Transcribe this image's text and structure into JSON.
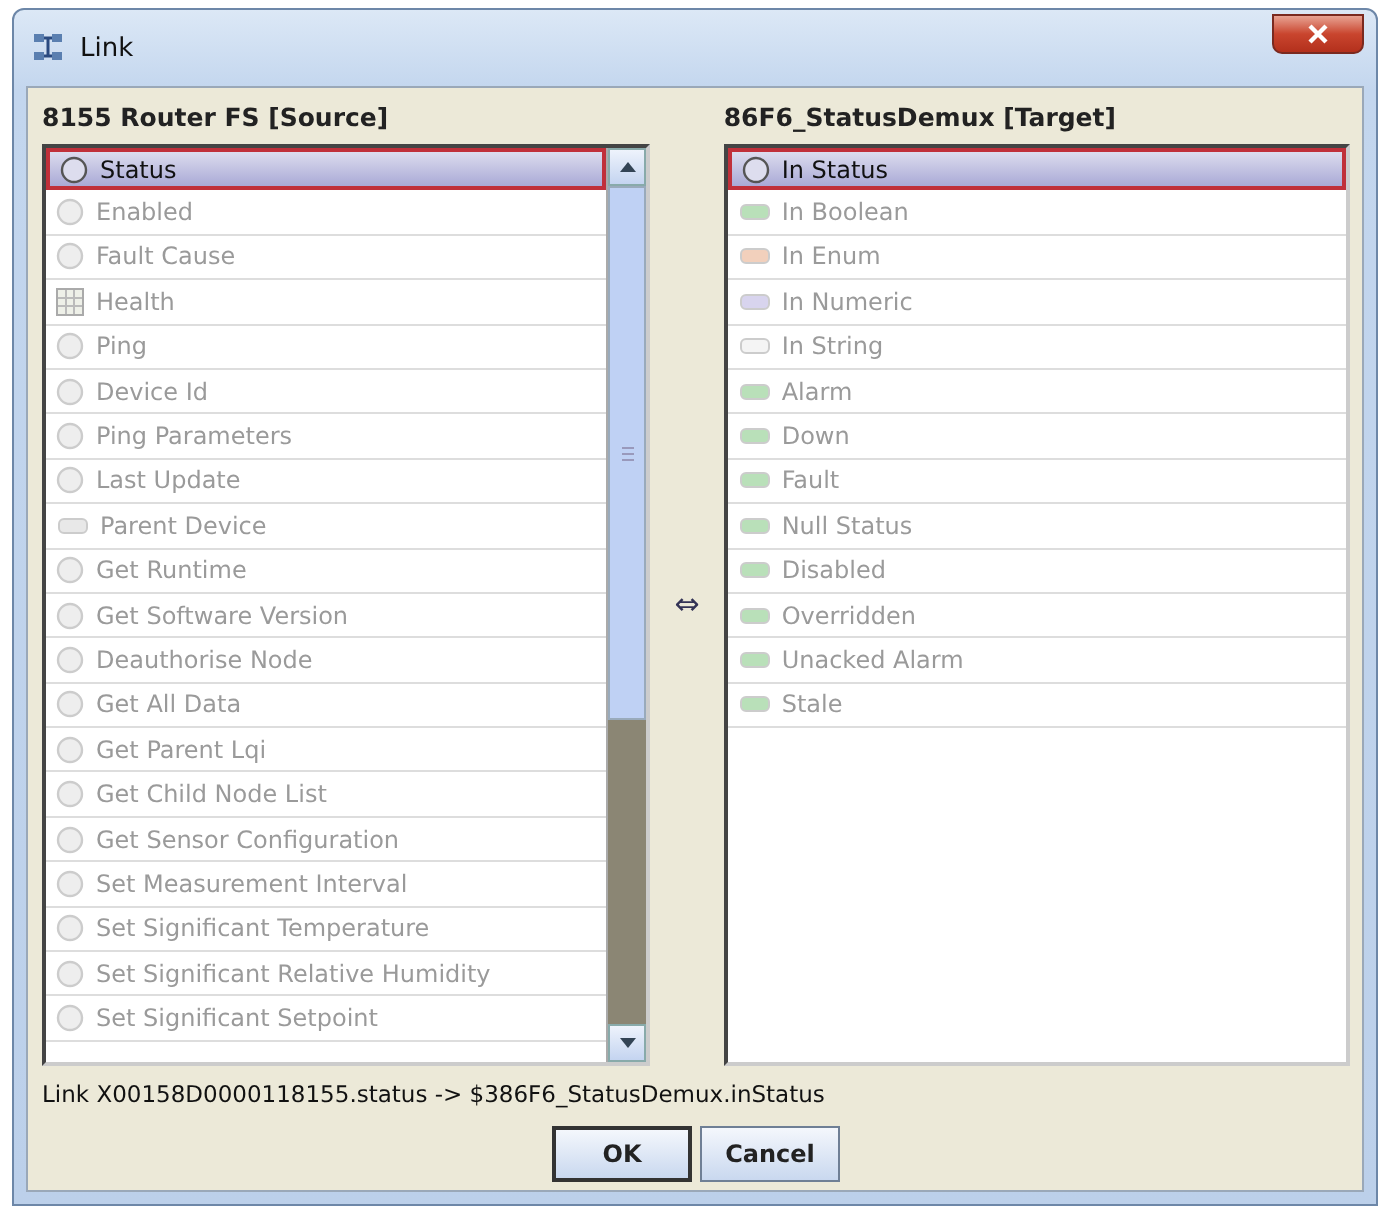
{
  "window": {
    "title": "Link"
  },
  "source": {
    "title": "8155 Router FS [Source]",
    "items": [
      {
        "label": "Status",
        "kind": "circle",
        "selected": true
      },
      {
        "label": "Enabled",
        "kind": "circle",
        "selected": false
      },
      {
        "label": "Fault Cause",
        "kind": "circle",
        "selected": false
      },
      {
        "label": "Health",
        "kind": "grid",
        "selected": false
      },
      {
        "label": "Ping",
        "kind": "circle",
        "selected": false
      },
      {
        "label": "Device Id",
        "kind": "circle",
        "selected": false
      },
      {
        "label": "Ping Parameters",
        "kind": "circle",
        "selected": false
      },
      {
        "label": "Last Update",
        "kind": "circle",
        "selected": false
      },
      {
        "label": "Parent Device",
        "kind": "pill",
        "color": "#e8e8e8",
        "selected": false
      },
      {
        "label": "Get Runtime",
        "kind": "circle",
        "selected": false
      },
      {
        "label": "Get Software Version",
        "kind": "circle",
        "selected": false
      },
      {
        "label": "Deauthorise Node",
        "kind": "circle",
        "selected": false
      },
      {
        "label": "Get All Data",
        "kind": "circle",
        "selected": false
      },
      {
        "label": "Get Parent Lqi",
        "kind": "circle",
        "selected": false
      },
      {
        "label": "Get Child Node List",
        "kind": "circle",
        "selected": false
      },
      {
        "label": "Get Sensor Configuration",
        "kind": "circle",
        "selected": false
      },
      {
        "label": "Set Measurement Interval",
        "kind": "circle",
        "selected": false
      },
      {
        "label": "Set Significant Temperature",
        "kind": "circle",
        "selected": false
      },
      {
        "label": "Set Significant Relative Humidity",
        "kind": "circle",
        "selected": false
      },
      {
        "label": "Set Significant Setpoint",
        "kind": "circle",
        "selected": false
      }
    ]
  },
  "link_arrow": "⇔",
  "target": {
    "title": "86F6_StatusDemux [Target]",
    "items": [
      {
        "label": "In Status",
        "kind": "circle",
        "selected": true
      },
      {
        "label": "In Boolean",
        "kind": "pill",
        "color": "#b9e0b9",
        "selected": false
      },
      {
        "label": "In Enum",
        "kind": "pill",
        "color": "#f2d0bc",
        "selected": false
      },
      {
        "label": "In Numeric",
        "kind": "pill",
        "color": "#d8d4ee",
        "selected": false
      },
      {
        "label": "In String",
        "kind": "pill",
        "color": "#f4f4f4",
        "selected": false
      },
      {
        "label": "Alarm",
        "kind": "pill",
        "color": "#b9e0b9",
        "selected": false
      },
      {
        "label": "Down",
        "kind": "pill",
        "color": "#b9e0b9",
        "selected": false
      },
      {
        "label": "Fault",
        "kind": "pill",
        "color": "#b9e0b9",
        "selected": false
      },
      {
        "label": "Null Status",
        "kind": "pill",
        "color": "#b9e0b9",
        "selected": false
      },
      {
        "label": "Disabled",
        "kind": "pill",
        "color": "#b9e0b9",
        "selected": false
      },
      {
        "label": "Overridden",
        "kind": "pill",
        "color": "#b9e0b9",
        "selected": false
      },
      {
        "label": "Unacked Alarm",
        "kind": "pill",
        "color": "#b9e0b9",
        "selected": false
      },
      {
        "label": "Stale",
        "kind": "pill",
        "color": "#b9e0b9",
        "selected": false
      }
    ]
  },
  "link_text": "Link X00158D0000118155.status -> $386F6_StatusDemux.inStatus",
  "buttons": [
    "OK",
    "Cancel"
  ]
}
